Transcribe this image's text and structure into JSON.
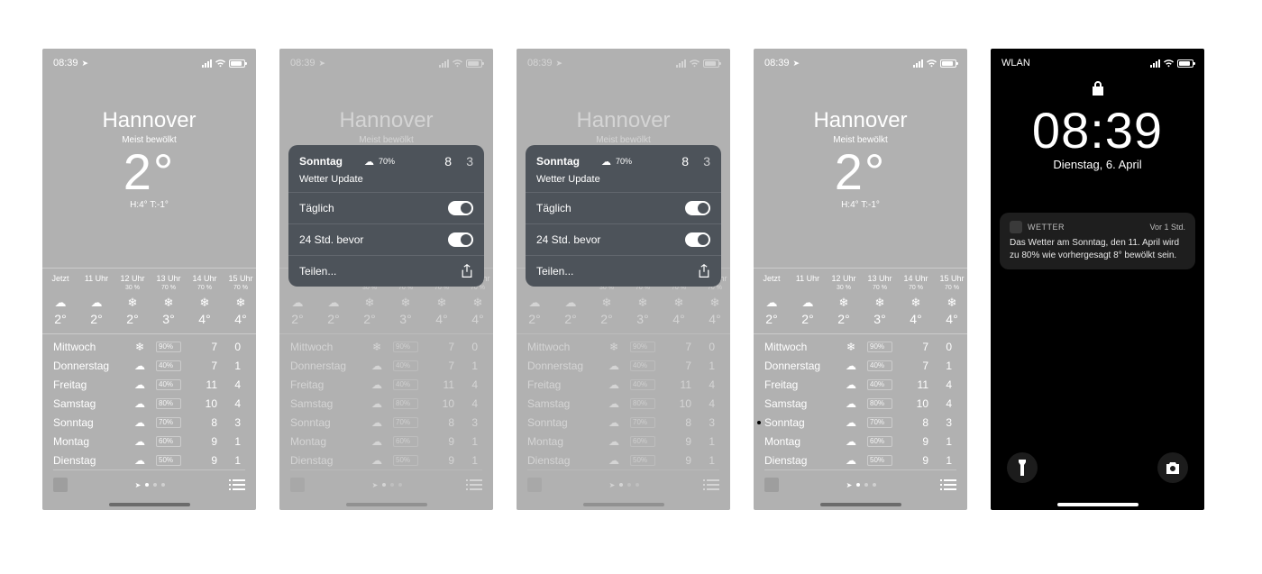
{
  "status_time": "08:39",
  "wlan_label": "WLAN",
  "city": {
    "name": "Hannover",
    "condition": "Meist bewölkt",
    "temp": "2°",
    "hilo": "H:4° T:-1°"
  },
  "hourly": [
    {
      "label": "Jetzt",
      "pct": "",
      "icon": "cloud",
      "temp": "2°"
    },
    {
      "label": "11 Uhr",
      "pct": "",
      "icon": "cloud",
      "temp": "2°"
    },
    {
      "label": "12 Uhr",
      "pct": "30 %",
      "icon": "snow",
      "temp": "2°"
    },
    {
      "label": "13 Uhr",
      "pct": "70 %",
      "icon": "snow",
      "temp": "3°"
    },
    {
      "label": "14 Uhr",
      "pct": "70 %",
      "icon": "snow",
      "temp": "4°"
    },
    {
      "label": "15 Uhr",
      "pct": "70 %",
      "icon": "snow",
      "temp": "4°"
    }
  ],
  "daily": [
    {
      "name": "Mittwoch",
      "icon": "snow",
      "pct": "90%",
      "high": "7",
      "low": "0"
    },
    {
      "name": "Donnerstag",
      "icon": "cloud",
      "pct": "40%",
      "high": "7",
      "low": "1"
    },
    {
      "name": "Freitag",
      "icon": "cloud",
      "pct": "40%",
      "high": "11",
      "low": "4"
    },
    {
      "name": "Samstag",
      "icon": "cloud",
      "pct": "80%",
      "high": "10",
      "low": "4"
    },
    {
      "name": "Sonntag",
      "icon": "cloud",
      "pct": "70%",
      "high": "8",
      "low": "3"
    },
    {
      "name": "Montag",
      "icon": "cloud",
      "pct": "60%",
      "high": "9",
      "low": "1"
    },
    {
      "name": "Dienstag",
      "icon": "cloud",
      "pct": "50%",
      "high": "9",
      "low": "1"
    }
  ],
  "popup": {
    "day": "Sonntag",
    "icon": "cloud",
    "pct": "70%",
    "high": "8",
    "low": "3",
    "sub": "Wetter Update",
    "row1": "Täglich",
    "row2": "24 Std. bevor",
    "share": "Teilen..."
  },
  "lock": {
    "time": "08:39",
    "date": "Dienstag, 6. April",
    "notif_app": "WETTER",
    "notif_time": "Vor 1 Std.",
    "notif_body": "Das Wetter am Sonntag, den 11. April wird zu 80% wie vorhergesagt 8° bewölkt sein."
  },
  "dot_index_phone4": 4
}
